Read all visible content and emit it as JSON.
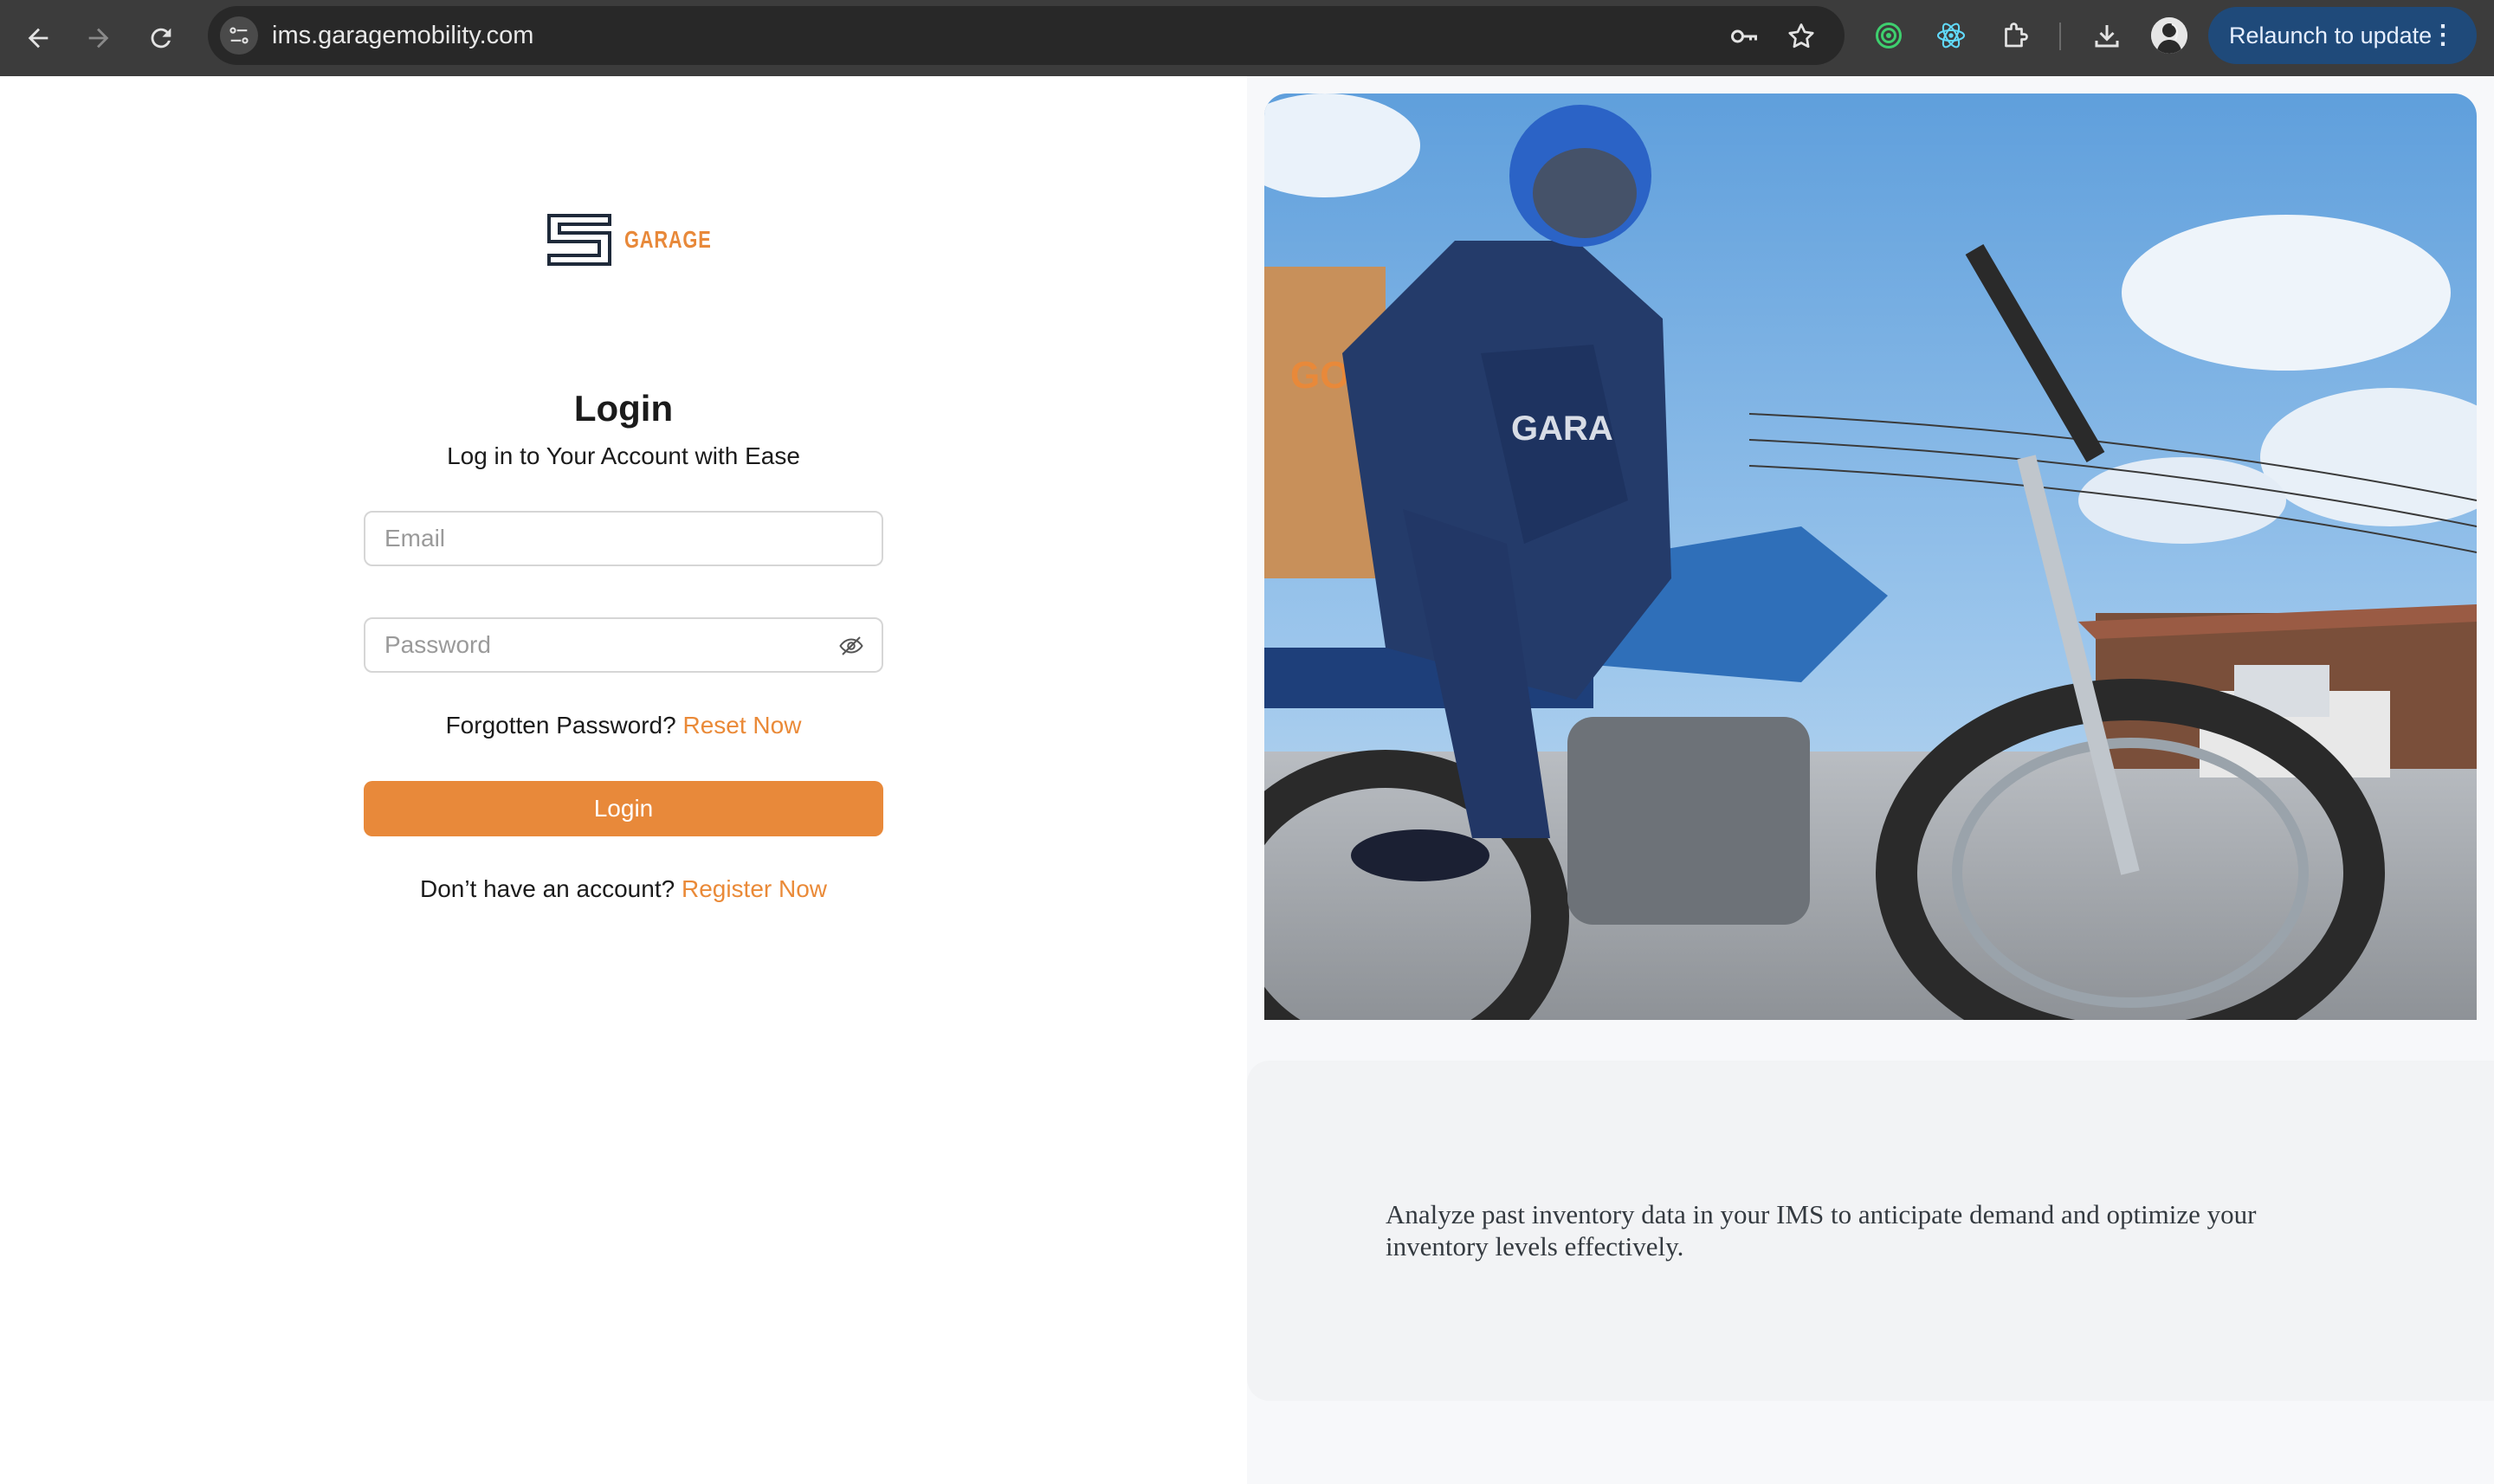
{
  "browser": {
    "url": "ims.garagemobility.com",
    "relaunch_label": "Relaunch to update",
    "icons": [
      "back-arrow-icon",
      "forward-arrow-icon",
      "reload-icon",
      "site-settings-icon",
      "password-key-icon",
      "bookmark-star-icon",
      "extension-target-icon",
      "react-devtools-icon",
      "extensions-puzzle-icon",
      "download-icon",
      "profile-avatar",
      "more-vert-icon"
    ]
  },
  "brand": {
    "logo_text": "GARAGE",
    "accent_color": "#e8893a",
    "dark_color": "#1f2a3a"
  },
  "login": {
    "title": "Login",
    "subtitle": "Log in to Your Account with Ease",
    "email_placeholder": "Email",
    "password_placeholder": "Password",
    "forgot_text": "Forgotten Password?",
    "reset_link": "Reset Now",
    "button_label": "Login",
    "register_text": "Don’t have an account?",
    "register_link": "Register Now"
  },
  "hero": {
    "image_description_icon": "motorcycle-rider-photo",
    "caption": "Analyze past inventory data in your IMS to anticipate demand and optimize your inventory levels effectively."
  }
}
